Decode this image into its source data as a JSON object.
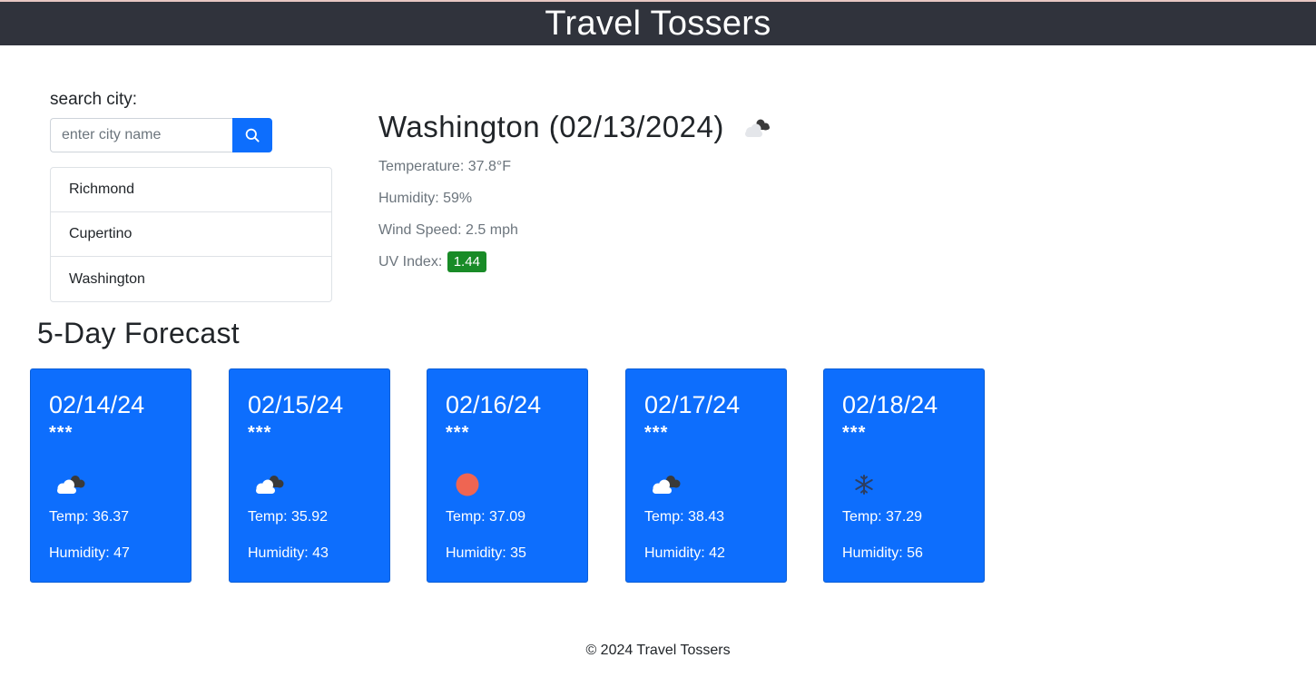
{
  "header": {
    "title": "Travel Tossers"
  },
  "search": {
    "label": "search city:",
    "placeholder": "enter city name",
    "button_icon": "search-icon"
  },
  "history": [
    {
      "label": "Richmond"
    },
    {
      "label": "Cupertino"
    },
    {
      "label": "Washington"
    }
  ],
  "current": {
    "title": "Washington (02/13/2024)",
    "icon": "clouds-icon",
    "temperature": "Temperature: 37.8°F",
    "humidity": "Humidity: 59%",
    "wind": "Wind Speed: 2.5 mph",
    "uv_label": "UV Index:",
    "uv_value": "1.44",
    "uv_color": "#198b27"
  },
  "forecast": {
    "title": "5-Day Forecast",
    "days": [
      {
        "date": "02/14/24",
        "stars": "***",
        "icon": "clouds-icon",
        "temp": "Temp: 36.37",
        "humidity": "Humidity: 47"
      },
      {
        "date": "02/15/24",
        "stars": "***",
        "icon": "clouds-icon",
        "temp": "Temp: 35.92",
        "humidity": "Humidity: 43"
      },
      {
        "date": "02/16/24",
        "stars": "***",
        "icon": "sun-icon",
        "temp": "Temp: 37.09",
        "humidity": "Humidity: 35"
      },
      {
        "date": "02/17/24",
        "stars": "***",
        "icon": "clouds-icon",
        "temp": "Temp: 38.43",
        "humidity": "Humidity: 42"
      },
      {
        "date": "02/18/24",
        "stars": "***",
        "icon": "snowflake-icon",
        "temp": "Temp: 37.29",
        "humidity": "Humidity: 56"
      }
    ]
  },
  "colors": {
    "header_bg": "#30333c",
    "accent": "#0d6efd",
    "uv_low": "#198b27"
  },
  "footer": {
    "text": "© 2024 Travel Tossers"
  }
}
